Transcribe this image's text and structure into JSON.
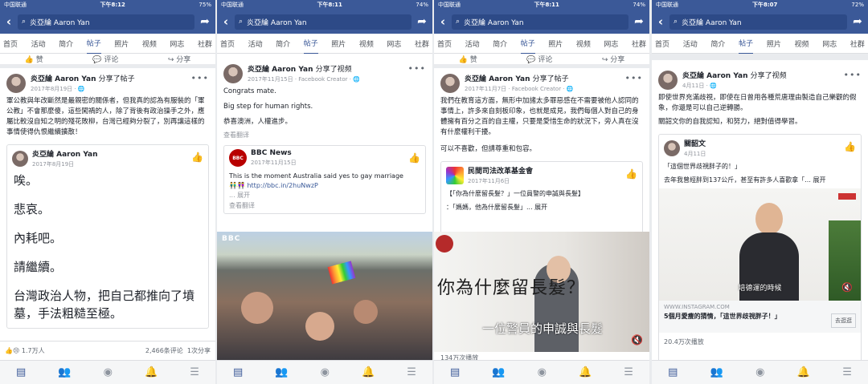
{
  "common": {
    "carrier": "中国联通",
    "search_text": "炎亞綸 Aaron Yan",
    "tabs": [
      "首页",
      "活动",
      "简介",
      "帖子",
      "照片",
      "视频",
      "网志",
      "社群"
    ],
    "active_tab": "帖子",
    "like_label": "赞",
    "comment_label": "评论",
    "share_label": "分享"
  },
  "panel1": {
    "time": "下午8:12",
    "battery": "75%",
    "author": "炎亞綸 Aaron Yan",
    "action": "分享了帖子",
    "date": "2017年8月19日",
    "body": "軍公教與年改斷然是最親密的關係者，但我真的認為有服裝的「軍公教」不會那麼傻，這些闖禍的人，除了背後有政治操手之外，應屬比較沒自知之明的殘花敗柳，台灣已經夠分裂了，別再讓這樣的事情使得仇恨繼續擴散！",
    "shared_author": "炎亞綸 Aaron Yan",
    "shared_date": "2017年8月19日",
    "shared_lines": [
      "唉。",
      "悲哀。",
      "內耗吧。",
      "請繼續。",
      "台灣政治人物，把自己都推向了墳墓，手法粗糙至極。"
    ],
    "reactions": "1.7万人",
    "comments": "2,466条评论",
    "shares": "1次分享"
  },
  "panel2": {
    "time": "下午8:11",
    "battery": "74%",
    "author": "炎亞綸 Aaron Yan",
    "action": "分享了视频",
    "date": "2017年11月15日 · Facebook Creator",
    "line1": "Congrats mate.",
    "line2": "Big step for human rights.",
    "line3": "恭喜澳洲，人權進步。",
    "translate": "查看翻译",
    "shared_author": "BBC News",
    "shared_date": "2017年11月15日",
    "shared_text": "This is the moment Australia said yes to gay marriage",
    "shared_link": "http://bbc.in/2huNwzP",
    "expand": "... 展开",
    "shared_translate": "查看翻译",
    "logo": "BBC"
  },
  "panel3": {
    "time": "下午8:11",
    "battery": "74%",
    "author": "炎亞綸 Aaron Yan",
    "action": "分享了帖子",
    "date": "2017年11月7日 · Facebook Creator",
    "body": "我們在教育這方面，無形中加諸太多罪惡感在不需要被他人認同的事情上，許多來自刻板印象，也就是成見，我們每個人對自己的身體擁有百分之百的自主權，只要是愛惜生命的狀況下，旁人真在沒有什麼權利干擾。",
    "body2": "可以不喜歡，但請尊重和包容。",
    "shared_author": "民間司法改革基金會",
    "shared_date": "2017年11月6日",
    "shared_title": "【「你為什麼留長髮？」一位員警的申誠與長髮】",
    "shared_quote": "：「媽媽，他為什麼留長髮」... 展开",
    "video_title": "你為什麼留長髮？",
    "video_sub": "一位警員的申誠與長髮",
    "footer": "134万次播放"
  },
  "panel4": {
    "time": "下午8:07",
    "battery": "72%",
    "author": "炎亞綸 Aaron Yan",
    "action": "分享了视频",
    "date": "4月11日",
    "body": "即使世界充滿歧視，即使在日曾用各種荒唐理由製造自己樂觀的假象，你還是可以自己逆轉勝。",
    "body2": "關韶文你的自我認知，和努力，絕對值得學習。",
    "shared_author": "關韶文",
    "shared_date": "4月11日",
    "shared_q": "「這個世界歧視胖子的！」",
    "shared_text": "去年我曾經胖到137公斤，甚至有許多人喜歡拿「... 展开",
    "caption": "培德運的時候",
    "link_url": "WWW.INSTAGRAM.COM",
    "link_title": "5個月愛瘦的猜情，「這世界歧視胖子！」",
    "link_btn": "去逛逛",
    "views": "20.4万次播放"
  }
}
